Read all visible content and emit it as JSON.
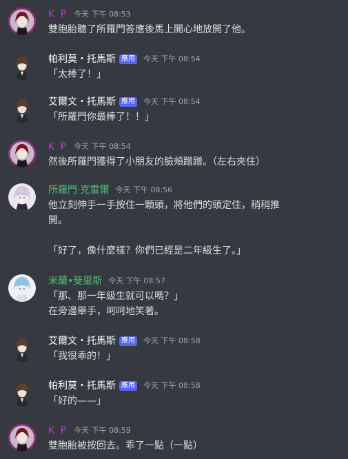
{
  "colors": {
    "background": "#36393f",
    "text": "#dcddde",
    "timestamp": "#a3a6aa",
    "kp_name": "#b93fcf",
    "app_name": "#ffffff",
    "teal_name": "#4fbf78",
    "badge_bg": "#5865f2"
  },
  "messages": [
    {
      "author": "K P",
      "badge": "",
      "time": "今天 下午 08:53",
      "avatar": "kp-avatar",
      "lines": [
        "雙胞胎聽了所羅門答應後馬上開心地放開了他。"
      ]
    },
    {
      "author": "帕利莫・托馬斯",
      "badge": "應用",
      "time": "今天 下午 08:54",
      "avatar": "brown-hair-avatar",
      "lines": [
        "「太棒了！」"
      ]
    },
    {
      "author": "艾爾文・托馬斯",
      "badge": "應用",
      "time": "今天 下午 08:54",
      "avatar": "brown-hair-avatar",
      "lines": [
        "「所羅門你最棒了！！」"
      ]
    },
    {
      "author": "K P",
      "badge": "",
      "time": "今天 下午 08:54",
      "avatar": "kp-avatar",
      "lines": [
        "然後所羅門獲得了小朋友的臉頰蹭蹭。（左右夾住）"
      ]
    },
    {
      "author": "所羅門·克雷爾",
      "badge": "",
      "time": "今天 下午 08:56",
      "avatar": "silver-hair-avatar",
      "lines": [
        "他立刻伸手一手按住一顆頭，將他們的頭定住，稍稍推",
        "開。",
        "",
        "「好了，像什麼樣？你們已經是二年級生了。」"
      ]
    },
    {
      "author": "米蘭•斐里斯",
      "badge": "",
      "time": "今天 下午 08:57",
      "avatar": "blue-hair-avatar",
      "lines": [
        "「那、那一年級生就可以嗎？」",
        "在旁邊舉手，呵呵地笑著。"
      ]
    },
    {
      "author": "艾爾文・托馬斯",
      "badge": "應用",
      "time": "今天 下午 08:58",
      "avatar": "brown-hair-avatar",
      "lines": [
        "「我很乖的！」"
      ]
    },
    {
      "author": "帕利莫・托馬斯",
      "badge": "應用",
      "time": "今天 下午 08:58",
      "avatar": "brown-hair-avatar",
      "lines": [
        "「好的——」"
      ]
    },
    {
      "author": "K P",
      "badge": "",
      "time": "今天 下午 08:59",
      "avatar": "kp-avatar",
      "lines": [
        "雙胞胎被按回去。乖了一點（一點）"
      ]
    }
  ]
}
